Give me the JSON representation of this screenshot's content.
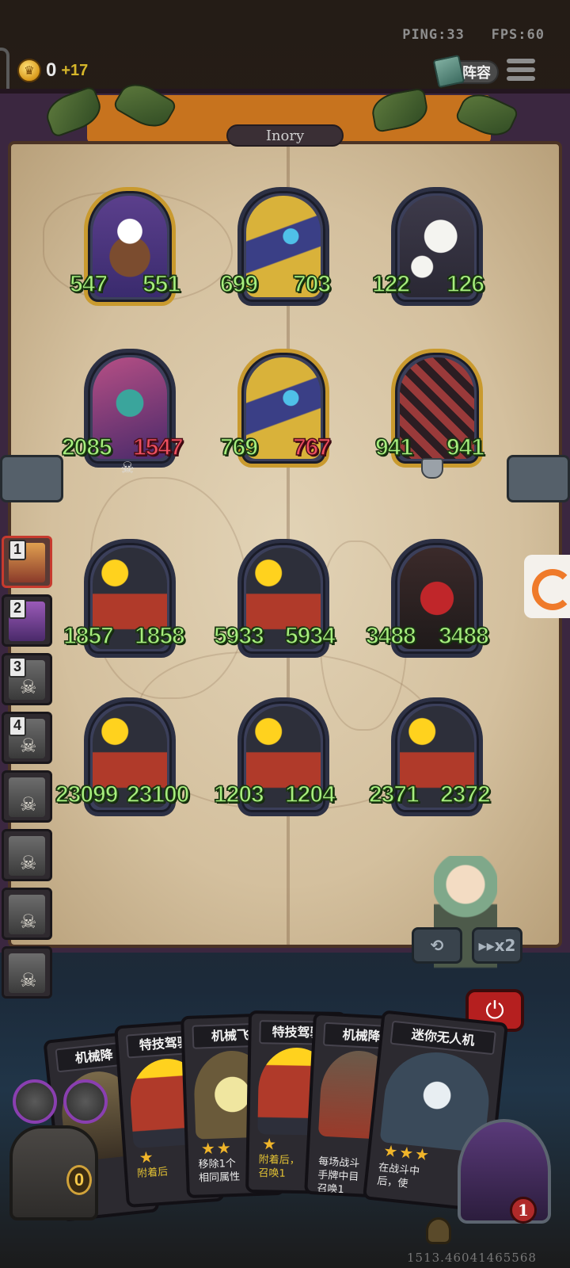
{
  "hud": {
    "ping_text": "PING:33",
    "fps_text": "FPS:60",
    "gold": "0",
    "gold_income": "+17",
    "lineup_label": "阵容",
    "coin_icon": "coin-icon",
    "menu_icon": "hamburger-menu-icon"
  },
  "board": {
    "owner_name": "Inory",
    "enemy_row1": [
      {
        "art": "chef",
        "attack": "547",
        "health": "551",
        "health_damaged": false
      },
      {
        "art": "totem",
        "attack": "699",
        "health": "703",
        "health_damaged": false
      },
      {
        "art": "flower",
        "attack": "122",
        "health": "126",
        "health_damaged": false
      }
    ],
    "enemy_row2": [
      {
        "art": "mech",
        "attack": "2085",
        "health": "1547",
        "health_damaged": true
      },
      {
        "art": "totem",
        "attack": "769",
        "health": "767",
        "health_damaged": true
      },
      {
        "art": "harlequin",
        "attack": "941",
        "health": "941",
        "health_damaged": false
      }
    ],
    "own_row1": [
      {
        "art": "truck",
        "attack": "1857",
        "health": "1858"
      },
      {
        "art": "truck",
        "attack": "5933",
        "health": "5934"
      },
      {
        "art": "robot",
        "attack": "3488",
        "health": "3488"
      }
    ],
    "own_row2": [
      {
        "art": "truck",
        "attack": "23099",
        "health": "23100"
      },
      {
        "art": "truck",
        "attack": "1203",
        "health": "1204"
      },
      {
        "art": "truck",
        "attack": "2371",
        "health": "2372"
      }
    ]
  },
  "roster": [
    {
      "rank": "1",
      "status": "active"
    },
    {
      "rank": "2",
      "status": "alive"
    },
    {
      "rank": "3",
      "status": "dead"
    },
    {
      "rank": "4",
      "status": "dead"
    },
    {
      "rank": "",
      "status": "dead"
    },
    {
      "rank": "",
      "status": "dead"
    },
    {
      "rank": "",
      "status": "dead"
    },
    {
      "rank": "",
      "status": "dead"
    }
  ],
  "controls": {
    "replay_icon": "replay-icon",
    "speed_label": "x2",
    "power_icon": "power-icon"
  },
  "hand": [
    {
      "title": "机械降",
      "desc": ""
    },
    {
      "title": "特技驾驶",
      "stars": "★",
      "desc_html": "附着后"
    },
    {
      "title": "机械飞",
      "stars": "★★",
      "desc": "移除1个\n相同属性"
    },
    {
      "title": "特技驾驶",
      "stars": "★",
      "desc_html": "附着后，\n召唤1"
    },
    {
      "title": "机械降",
      "stars": "",
      "desc": "每场战斗\n手牌中目\n召唤1"
    },
    {
      "title": "迷你无人机",
      "stars": "★★★",
      "desc": "在战斗中\n后，使"
    }
  ],
  "bottom": {
    "chest_count": "0",
    "hero_health": "1",
    "coords_text": "1513.46041465568"
  }
}
